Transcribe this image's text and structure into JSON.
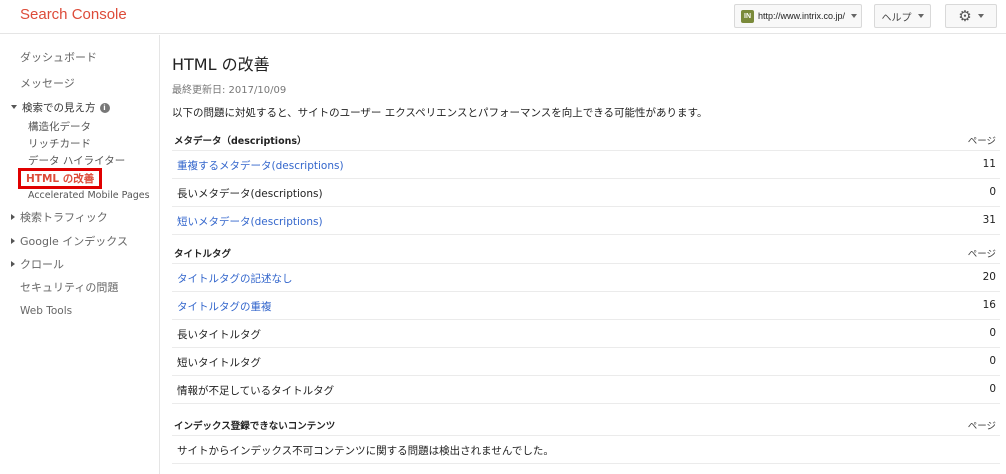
{
  "header": {
    "logo": "Search Console",
    "site": "http://www.intrix.co.jp/",
    "site_favicon_text": "IN",
    "help_label": "ヘルプ",
    "settings_icon": "gear-icon"
  },
  "sidebar": {
    "items": [
      {
        "label": "ダッシュボード"
      },
      {
        "label": "メッセージ"
      },
      {
        "label": "検索での見え方"
      },
      {
        "label": "構造化データ"
      },
      {
        "label": "リッチカード"
      },
      {
        "label": "データ ハイライター"
      },
      {
        "label": "HTML の改善"
      },
      {
        "label": "Accelerated Mobile Pages"
      },
      {
        "label": "検索トラフィック"
      },
      {
        "label": "Google インデックス"
      },
      {
        "label": "クロール"
      },
      {
        "label": "セキュリティの問題"
      },
      {
        "label": "Web Tools"
      }
    ]
  },
  "main": {
    "title": "HTML の改善",
    "updated": "最終更新日: 2017/10/09",
    "intro": "以下の問題に対処すると、サイトのユーザー エクスペリエンスとパフォーマンスを向上できる可能性があります。",
    "sections": [
      {
        "title": "メタデータ（descriptions）",
        "column": "ページ",
        "rows": [
          {
            "label": "重複するメタデータ(descriptions)",
            "count": "11"
          },
          {
            "label": "長いメタデータ(descriptions)",
            "count": "0"
          },
          {
            "label": "短いメタデータ(descriptions)",
            "count": "31"
          }
        ]
      },
      {
        "title": "タイトルタグ",
        "column": "ページ",
        "rows": [
          {
            "label": "タイトルタグの記述なし",
            "count": "20"
          },
          {
            "label": "タイトルタグの重複",
            "count": "16"
          },
          {
            "label": "長いタイトルタグ",
            "count": "0"
          },
          {
            "label": "短いタイトルタグ",
            "count": "0"
          },
          {
            "label": "情報が不足しているタイトルタグ",
            "count": "0"
          }
        ]
      },
      {
        "title": "インデックス登録できないコンテンツ",
        "column": "ページ",
        "message": "サイトからインデックス不可コンテンツに関する問題は検出されませんでした。"
      }
    ]
  },
  "colors": {
    "logo": "#dd4b39",
    "link": "#3366cc",
    "highlight_box": "#e00000"
  }
}
